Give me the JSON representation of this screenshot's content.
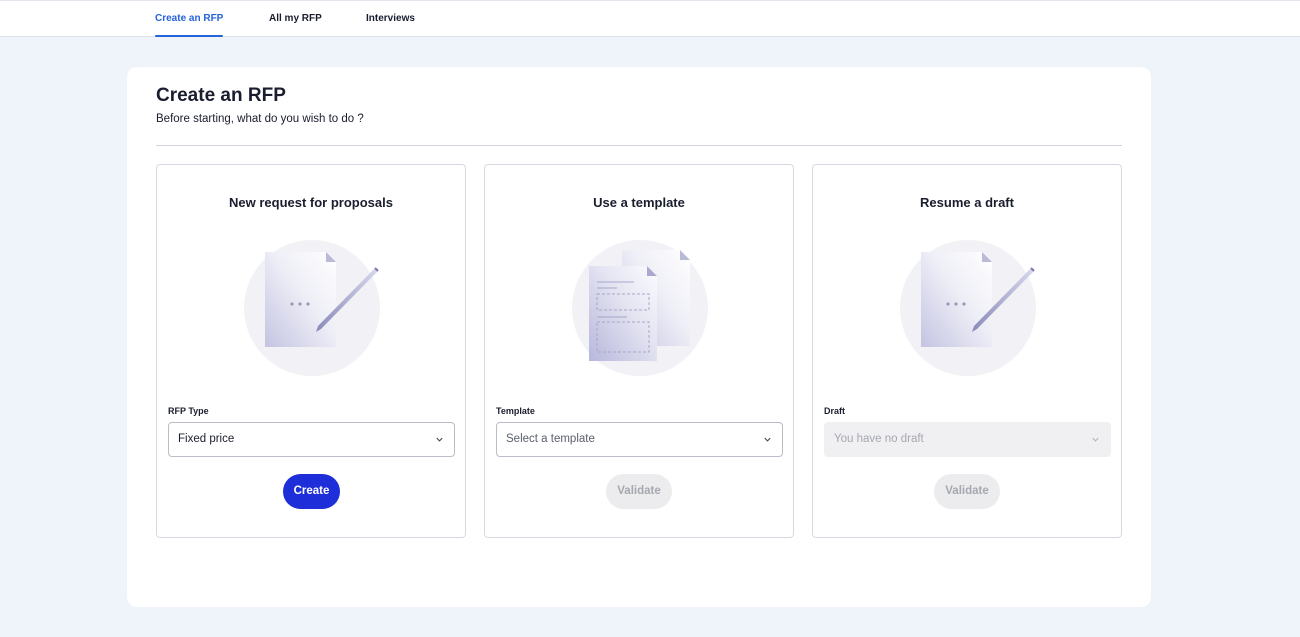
{
  "nav": {
    "tabs": [
      {
        "label": "Create an RFP",
        "active": true
      },
      {
        "label": "All my RFP",
        "active": false
      },
      {
        "label": "Interviews",
        "active": false
      }
    ]
  },
  "page": {
    "title": "Create an RFP",
    "subtitle": "Before starting, what do you wish to do ?"
  },
  "options": [
    {
      "title": "New request for proposals",
      "illustration": "document-with-pen",
      "field_label": "RFP Type",
      "select_value": "Fixed price",
      "button_label": "Create",
      "button_enabled": true
    },
    {
      "title": "Use a template",
      "illustration": "stacked-templates",
      "field_label": "Template",
      "select_placeholder": "Select a template",
      "button_label": "Validate",
      "button_enabled": false
    },
    {
      "title": "Resume a draft",
      "illustration": "document-with-pen",
      "field_label": "Draft",
      "select_placeholder": "You have no draft",
      "select_disabled": true,
      "button_label": "Validate",
      "button_enabled": false
    }
  ],
  "colors": {
    "accent": "#2563d9",
    "primary_button": "#1e2fd9",
    "background": "#eff3fa"
  }
}
